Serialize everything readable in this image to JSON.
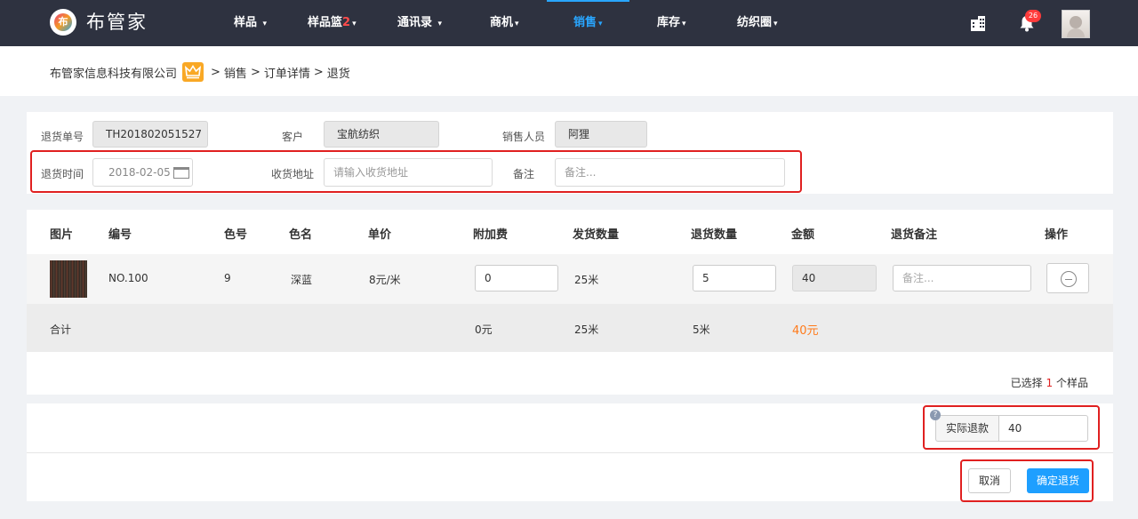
{
  "brand": {
    "name": "布管家",
    "logo_char": "布"
  },
  "nav": {
    "items": [
      {
        "label": "样品",
        "caret": "▾"
      },
      {
        "label": "样品篮",
        "badge": "2",
        "caret": "▾"
      },
      {
        "label": "通讯录",
        "caret": "▾"
      },
      {
        "label": "商机",
        "caret": "▾"
      },
      {
        "label": "销售",
        "caret": "▾",
        "active": true
      },
      {
        "label": "库存",
        "caret": "▾"
      },
      {
        "label": "纺织圈",
        "caret": "▾"
      }
    ],
    "notification_count": "26",
    "accent_color": "#29a6ff",
    "bg_color": "#2e3240"
  },
  "breadcrumb": {
    "company": "布管家信息科技有限公司",
    "sep": ">",
    "items": [
      "销售",
      "订单详情",
      "退货"
    ]
  },
  "form": {
    "return_no_label": "退货单号",
    "return_no": "TH201802051527",
    "customer_label": "客户",
    "customer": "宝航纺织",
    "salesperson_label": "销售人员",
    "salesperson": "阿狸",
    "return_time_label": "退货时间",
    "return_time": "2018-02-05",
    "address_label": "收货地址",
    "address_placeholder": "请输入收货地址",
    "remark_label": "备注",
    "remark_placeholder": "备注..."
  },
  "table": {
    "headers": [
      "图片",
      "编号",
      "色号",
      "色名",
      "单价",
      "附加费",
      "发货数量",
      "退货数量",
      "金额",
      "退货备注",
      "操作"
    ],
    "row": {
      "code": "NO.100",
      "color_no": "9",
      "color_name": "深蓝",
      "unit_price": "8元/米",
      "extra_fee": "0",
      "shipped_qty": "25米",
      "return_qty": "5",
      "amount": "40",
      "remark_placeholder": "备注..."
    },
    "total": {
      "label": "合计",
      "extra_fee": "0元",
      "shipped_qty": "25米",
      "return_qty": "5米",
      "amount": "40元"
    },
    "selection": {
      "prefix": "已选择",
      "count": "1",
      "suffix": "个样品"
    }
  },
  "refund": {
    "label": "实际退款",
    "value": "40",
    "help": "?"
  },
  "actions": {
    "cancel": "取消",
    "confirm": "确定退货",
    "confirm_color": "#1e9fff",
    "highlight_color": "#e02020"
  }
}
